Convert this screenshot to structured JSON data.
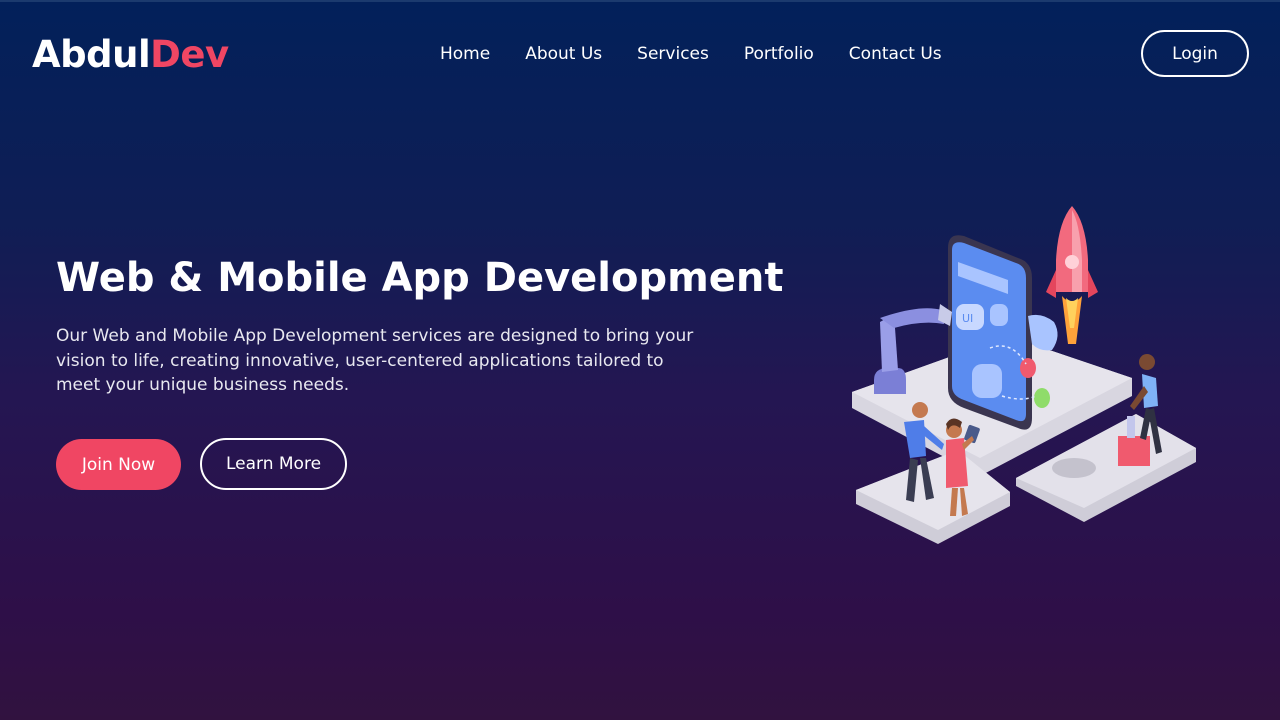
{
  "brand": {
    "part1": "Abdul",
    "part2": "Dev",
    "accent_color": "#f04663"
  },
  "nav": {
    "items": [
      {
        "label": "Home"
      },
      {
        "label": "About Us"
      },
      {
        "label": "Services"
      },
      {
        "label": "Portfolio"
      },
      {
        "label": "Contact Us"
      }
    ],
    "login_label": "Login"
  },
  "hero": {
    "title": "Web & Mobile App Development",
    "description": "Our Web and Mobile App Development services are designed to bring your vision to life, creating innovative, user-centered applications tailored to meet your unique business needs.",
    "primary_cta": "Join Now",
    "secondary_cta": "Learn More",
    "illustration": {
      "screen_label": "UI",
      "icon": "mobile-app-development-illustration"
    }
  }
}
